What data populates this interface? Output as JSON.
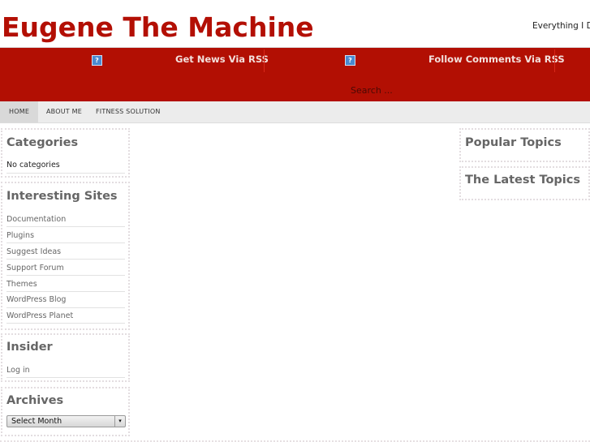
{
  "header": {
    "site_title": "Eugene The Machine",
    "tagline": "Everything I Do"
  },
  "feeds": {
    "news_label": "Get News Via RSS",
    "comments_label": "Follow Comments Via RSS",
    "icon_glyph": "?"
  },
  "search": {
    "placeholder": "Search ..."
  },
  "nav": {
    "items": [
      {
        "label": "HOME"
      },
      {
        "label": "ABOUT ME"
      },
      {
        "label": "FITNESS SOLUTION"
      }
    ]
  },
  "left_sidebar": {
    "categories": {
      "title": "Categories",
      "empty_text": "No categories"
    },
    "interesting_sites": {
      "title": "Interesting Sites",
      "links": [
        {
          "label": "Documentation"
        },
        {
          "label": "Plugins"
        },
        {
          "label": "Suggest Ideas"
        },
        {
          "label": "Support Forum"
        },
        {
          "label": "Themes"
        },
        {
          "label": "WordPress Blog"
        },
        {
          "label": "WordPress Planet"
        }
      ]
    },
    "insider": {
      "title": "Insider",
      "login_label": "Log in"
    },
    "archives": {
      "title": "Archives",
      "select_value": "Select Month",
      "arrow_glyph": "▾"
    }
  },
  "right_sidebar": {
    "popular_title": "Popular Topics",
    "latest_title": "The Latest Topics"
  }
}
